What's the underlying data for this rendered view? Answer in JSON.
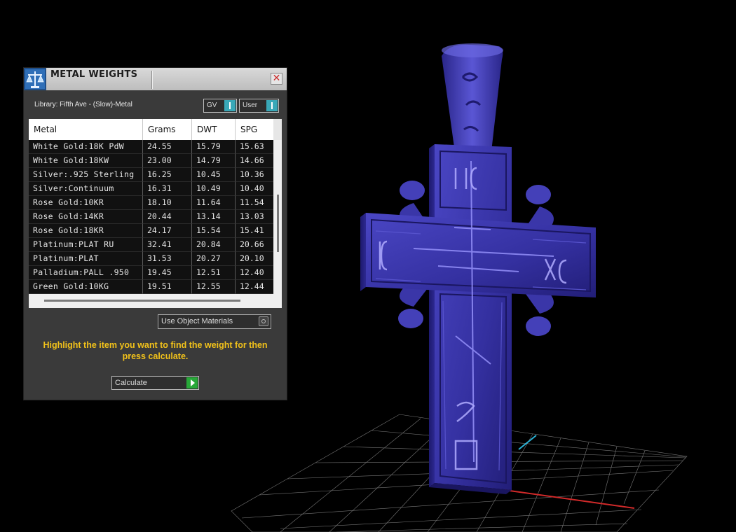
{
  "panel": {
    "title": "METAL WEIGHTS",
    "close_icon": "close-x-icon",
    "app_icon": "scale-icon",
    "library_label": "Library: Fifth Ave - (Slow)-Metal",
    "gv_toggle_label": "GV",
    "user_toggle_label": "User",
    "use_object_materials_label": "Use Object Materials",
    "instructions": "Highlight the item you want to find the weight for then press calculate.",
    "calculate_label": "Calculate",
    "accent_color": "#f2c21a",
    "toggle_color": "#39a8b8",
    "calculate_color": "#27a838"
  },
  "table": {
    "headers": [
      "Metal",
      "Grams",
      "DWT",
      "SPG"
    ],
    "rows": [
      [
        "White Gold:18K PdW",
        "24.55",
        "15.79",
        "15.63"
      ],
      [
        "White Gold:18KW",
        "23.00",
        "14.79",
        "14.66"
      ],
      [
        "Silver:.925 Sterling",
        "16.25",
        "10.45",
        "10.36"
      ],
      [
        "Silver:Continuum",
        "16.31",
        "10.49",
        "10.40"
      ],
      [
        "Rose Gold:10KR",
        "18.10",
        "11.64",
        "11.54"
      ],
      [
        "Rose Gold:14KR",
        "20.44",
        "13.14",
        "13.03"
      ],
      [
        "Rose Gold:18KR",
        "24.17",
        "15.54",
        "15.41"
      ],
      [
        "Platinum:PLAT RU",
        "32.41",
        "20.84",
        "20.66"
      ],
      [
        "Platinum:PLAT",
        "31.53",
        "20.27",
        "20.10"
      ],
      [
        "Palladium:PALL .950",
        "19.45",
        "12.51",
        "12.40"
      ],
      [
        "Green Gold:10KG",
        "19.51",
        "12.55",
        "12.44"
      ]
    ]
  },
  "viewport": {
    "model": "cross-pendant-model",
    "model_color": "#3a36a8",
    "grid_color": "#9a9a9a",
    "x_axis_color": "#d22a2a",
    "y_axis_color": "#2ab3d6"
  }
}
